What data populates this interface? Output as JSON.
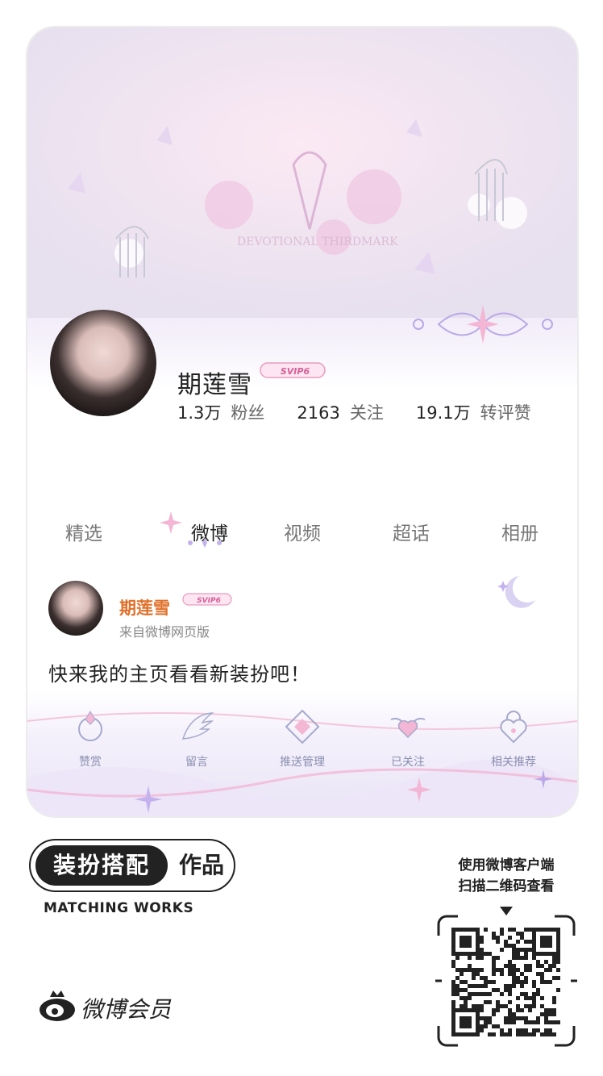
{
  "profile": {
    "name": "期莲雪",
    "badge": "SVIP6",
    "stats": [
      {
        "value": "1.3万",
        "label": "粉丝"
      },
      {
        "value": "2163",
        "label": "关注"
      },
      {
        "value": "19.1万",
        "label": "转评赞"
      }
    ]
  },
  "tabs": [
    {
      "label": "精选"
    },
    {
      "label": "微博"
    },
    {
      "label": "视频"
    },
    {
      "label": "超话"
    },
    {
      "label": "相册"
    }
  ],
  "post": {
    "author": "期莲雪",
    "badge": "SVIP6",
    "source": "来自微博网页版",
    "text": "快来我的主页看看新装扮吧！"
  },
  "actions": [
    {
      "label": "赞赏",
      "icon": "ring-icon"
    },
    {
      "label": "留言",
      "icon": "wing-icon"
    },
    {
      "label": "推送管理",
      "icon": "diamond-icon"
    },
    {
      "label": "已关注",
      "icon": "winged-heart-icon"
    },
    {
      "label": "相关推荐",
      "icon": "heart-lock-icon"
    }
  ],
  "footer": {
    "badge_dark": "装扮搭配",
    "badge_light": "作品",
    "subtitle": "MATCHING WORKS",
    "brand": "微博会员",
    "scan_line1": "使用微博客户端",
    "scan_line2": "扫描二维码查看"
  },
  "colors": {
    "accent_orange": "#e0702a",
    "lavender": "#e9e2f4",
    "pink": "#f3b6d4"
  }
}
